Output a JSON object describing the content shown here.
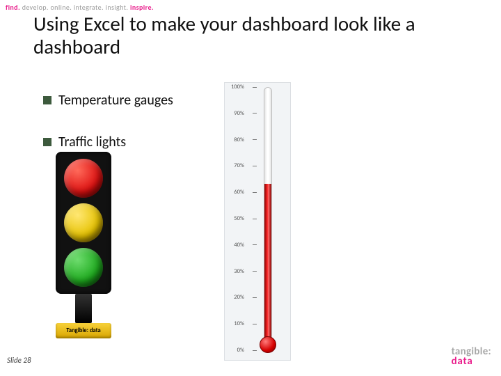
{
  "tagline": {
    "t1": "find.",
    "t2": "develop.",
    "t3": "online.",
    "t4": "integrate.",
    "t5": "insight.",
    "t6": "inspire."
  },
  "title": "Using Excel to make your dashboard look like a dashboard",
  "bullets": [
    {
      "label": "Temperature gauges"
    },
    {
      "label": "Traffic lights"
    }
  ],
  "traffic_light": {
    "base_label": "Tangible: data",
    "lamps": [
      "red",
      "yellow",
      "green"
    ]
  },
  "chart_data": {
    "type": "bar",
    "title": "",
    "xlabel": "",
    "ylabel": "",
    "categories": [
      "value"
    ],
    "values": [
      62
    ],
    "ylim": [
      0,
      100
    ],
    "ticks": [
      "100%",
      "90%",
      "80%",
      "70%",
      "60%",
      "50%",
      "40%",
      "30%",
      "20%",
      "10%",
      "0%"
    ],
    "unit": "%"
  },
  "footer": {
    "slide_label": "Slide 28",
    "logo_line1": "tangible:",
    "logo_line2": "data"
  }
}
